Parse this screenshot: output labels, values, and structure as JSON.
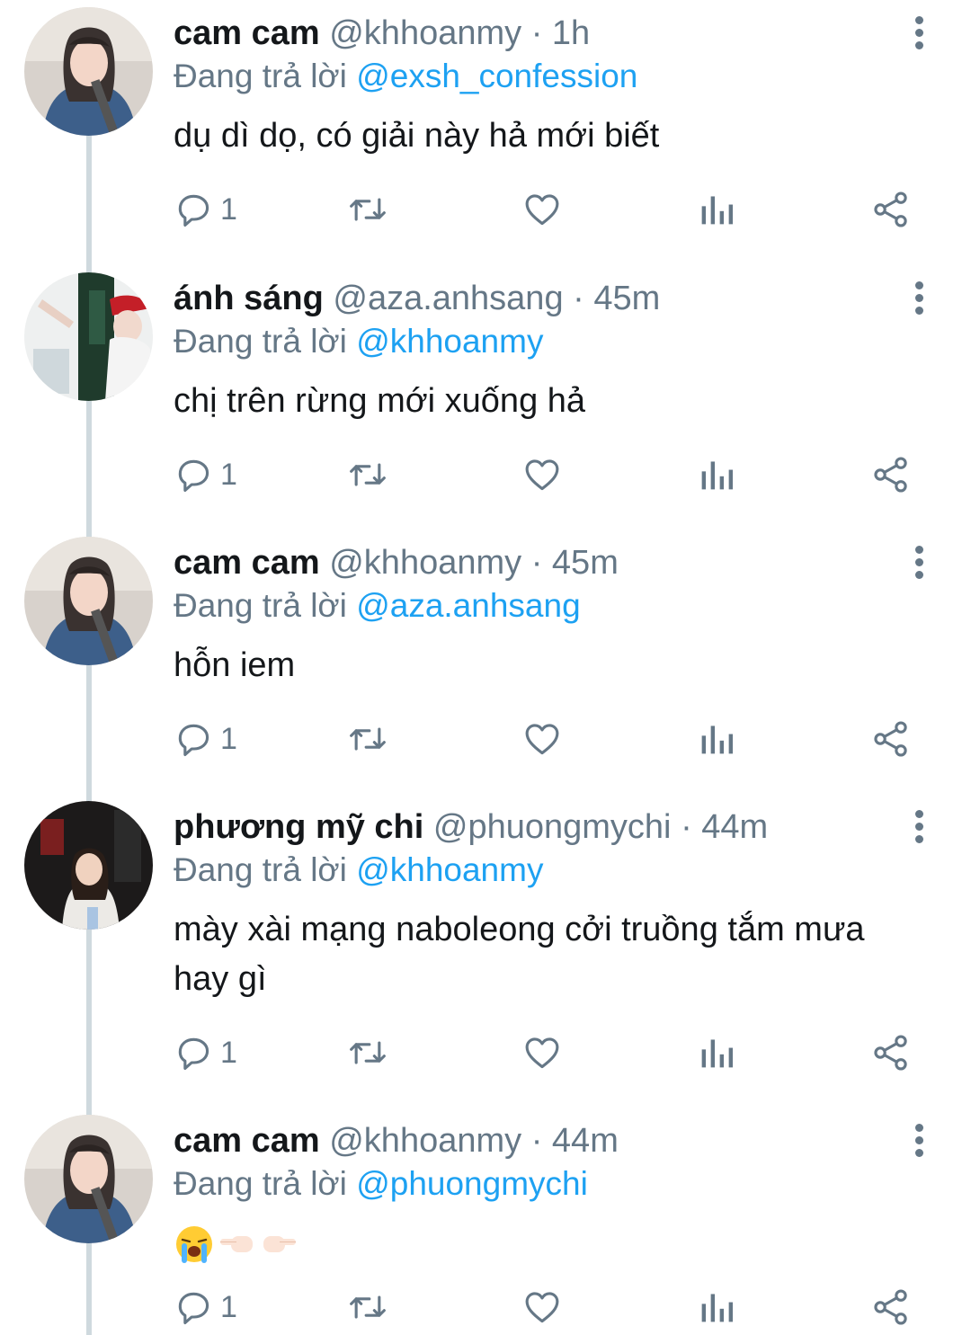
{
  "colors": {
    "link": "#1da1f2",
    "muted": "#657786",
    "text": "#14171a",
    "thread_line": "#cfd9de"
  },
  "replying_prefix": "Đang trả lời",
  "tweets": [
    {
      "name": "cam cam",
      "handle": "@khhoanmy",
      "separator": "·",
      "time": "1h",
      "replying_to": "@exsh_confession",
      "text": "dụ dì dọ, có giải này hả mới biết",
      "reply_count": "1",
      "avatar_icon": "avatar-photo"
    },
    {
      "name": "ánh sáng",
      "handle": "@aza.anhsang",
      "separator": "·",
      "time": "45m",
      "replying_to": "@khhoanmy",
      "text": "chị trên rừng mới xuống hả",
      "reply_count": "1",
      "avatar_icon": "avatar-photo"
    },
    {
      "name": "cam cam",
      "handle": "@khhoanmy",
      "separator": "·",
      "time": "45m",
      "replying_to": "@aza.anhsang",
      "text": "hỗn iem",
      "reply_count": "1",
      "avatar_icon": "avatar-photo"
    },
    {
      "name": "phương mỹ chi",
      "handle": "@phuongmychi",
      "separator": "·",
      "time": "44m",
      "replying_to": "@khhoanmy",
      "text": "mày xài mạng naboleong cởi truồng tắm mưa hay gì",
      "reply_count": "1",
      "avatar_icon": "avatar-photo"
    },
    {
      "name": "cam cam",
      "handle": "@khhoanmy",
      "separator": "·",
      "time": "44m",
      "replying_to": "@phuongmychi",
      "text": "",
      "emojis": [
        "loudly-crying-face",
        "pointing-left-hand",
        "pointing-right-hand"
      ],
      "reply_count": "1",
      "avatar_icon": "avatar-photo"
    }
  ]
}
